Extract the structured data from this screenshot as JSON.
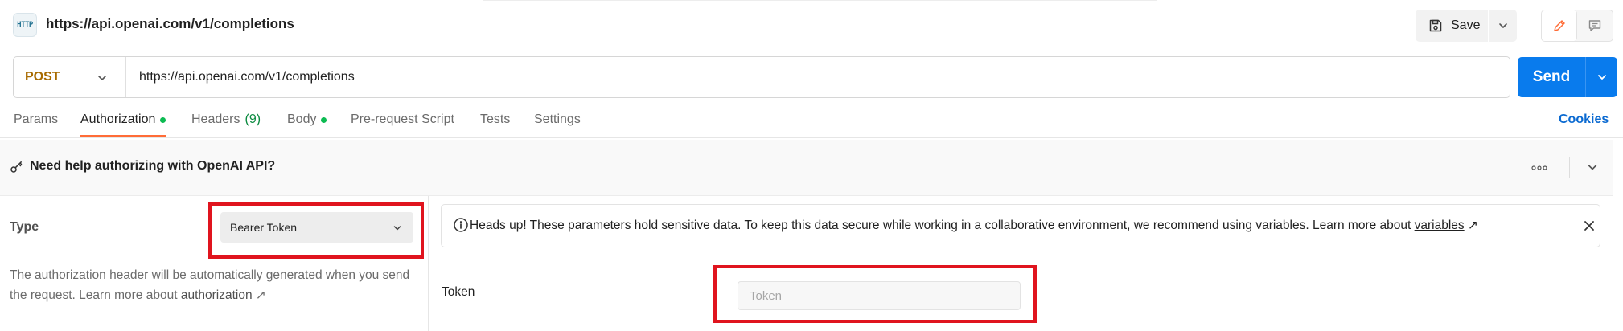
{
  "request": {
    "title": "https://api.openai.com/v1/completions",
    "icon_text": "HTTP",
    "method": "POST",
    "url": "https://api.openai.com/v1/completions"
  },
  "toolbar": {
    "save_label": "Save",
    "send_label": "Send"
  },
  "tabs": [
    {
      "label": "Params"
    },
    {
      "label": "Authorization"
    },
    {
      "label": "Headers",
      "count": "(9)"
    },
    {
      "label": "Body"
    },
    {
      "label": "Pre-request Script"
    },
    {
      "label": "Tests"
    },
    {
      "label": "Settings"
    }
  ],
  "cookies_label": "Cookies",
  "help_banner": {
    "text": "Need help authorizing with OpenAI API?"
  },
  "auth": {
    "type_label": "Type",
    "type_value": "Bearer Token",
    "description_prefix": "The authorization header will be automatically generated when you send the request. Learn more about ",
    "description_link": "authorization",
    "arrow": "↗",
    "warning_prefix": "Heads up! These parameters hold sensitive data. To keep this data secure while working in a collaborative environment, we recommend using variables. Learn more about ",
    "warning_link": "variables",
    "token_label": "Token",
    "token_placeholder": "Token",
    "token_value": ""
  },
  "colors": {
    "accent_orange": "#ff6c37",
    "send_blue": "#097bed",
    "method_post": "#a86b00",
    "dot_green": "#0cbb52",
    "highlight_red": "#e0141e"
  }
}
